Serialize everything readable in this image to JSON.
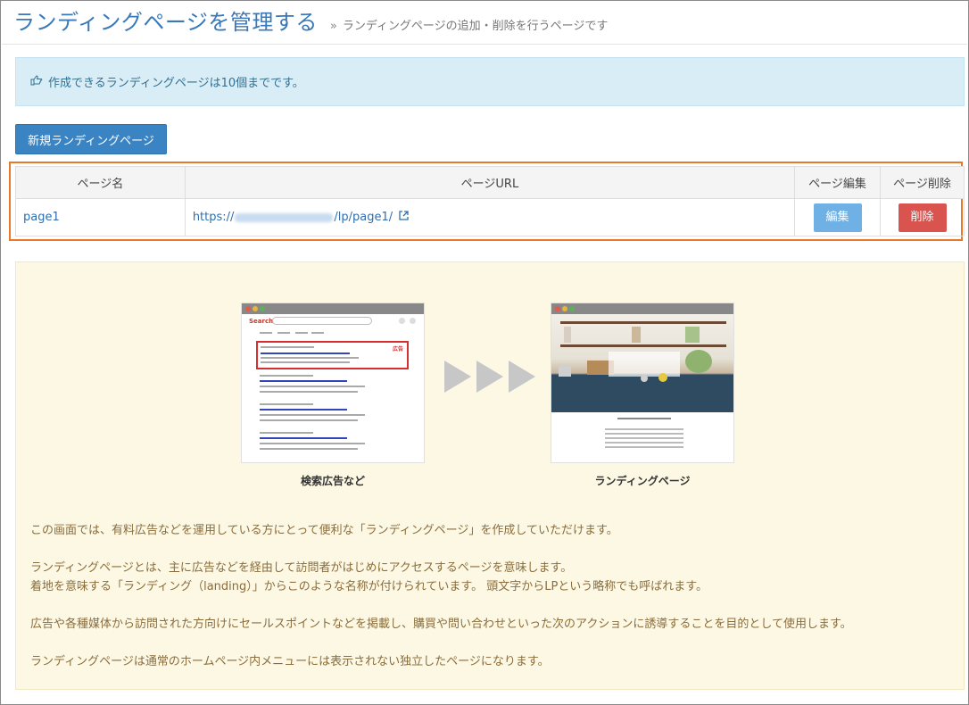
{
  "header": {
    "title": "ランディングページを管理する",
    "separator": "»",
    "subtitle": "ランディングページの追加・削除を行うページです"
  },
  "notice": {
    "icon": "hand-point-right-icon",
    "text": "作成できるランディングページは10個までです。"
  },
  "new_button_label": "新規ランディングページ",
  "table": {
    "columns": [
      "ページ名",
      "ページURL",
      "ページ編集",
      "ページ削除"
    ],
    "rows": [
      {
        "name": "page1",
        "url_prefix": "https://",
        "url_suffix": "/lp/page1/",
        "edit_label": "編集",
        "delete_label": "削除"
      }
    ]
  },
  "illustration": {
    "left_caption": "検索広告など",
    "right_caption": "ランディングページ",
    "search_logo": "Search",
    "ad_badge": "広告"
  },
  "description": {
    "p1": "この画面では、有料広告などを運用している方にとって便利な「ランディングページ」を作成していただけます。",
    "p2a": "ランディングページとは、主に広告などを経由して訪問者がはじめにアクセスするページを意味します。",
    "p2b": "着地を意味する「ランディング（landing）」からこのような名称が付けられています。 頭文字からLPという略称でも呼ばれます。",
    "p3": "広告や各種媒体から訪問された方向けにセールスポイントなどを掲載し、購買や問い合わせといった次のアクションに誘導することを目的として使用します。",
    "p4": "ランディングページは通常のホームページ内メニューには表示されない独立したページになります。"
  },
  "colors": {
    "accent": "#3a78b8",
    "notice_bg": "#d9edf7",
    "delete": "#d9534f",
    "edit": "#6fb1e4",
    "info_bg": "#fdf8e4",
    "highlight": "#e8792a"
  }
}
